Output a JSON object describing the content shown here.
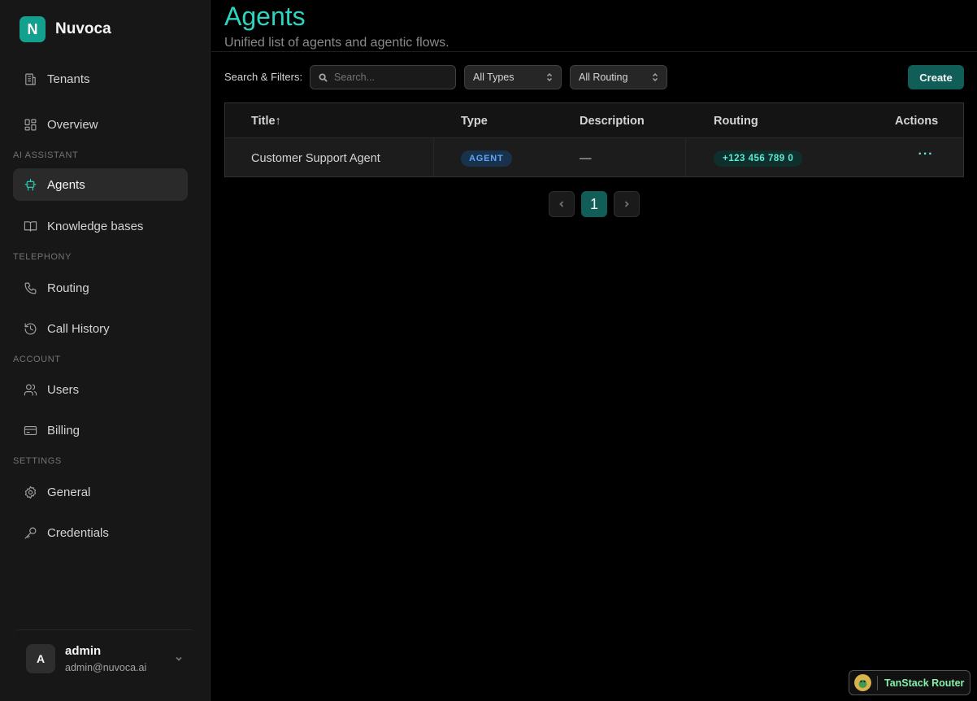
{
  "brand": {
    "logo_letter": "N",
    "name": "Nuvoca"
  },
  "sidebar": {
    "items": [
      {
        "label": "Tenants",
        "icon": "building-icon"
      },
      {
        "label": "Overview",
        "icon": "dashboard-icon"
      },
      {
        "label": "Agents",
        "icon": "bot-icon",
        "active": true
      },
      {
        "label": "Knowledge bases",
        "icon": "book-icon"
      },
      {
        "label": "Routing",
        "icon": "phone-icon"
      },
      {
        "label": "Call History",
        "icon": "history-icon"
      },
      {
        "label": "Users",
        "icon": "users-icon"
      },
      {
        "label": "Billing",
        "icon": "credit-card-icon"
      },
      {
        "label": "General",
        "icon": "gear-icon"
      },
      {
        "label": "Credentials",
        "icon": "key-icon"
      }
    ],
    "sections": [
      "AI ASSISTANT",
      "TELEPHONY",
      "ACCOUNT",
      "SETTINGS"
    ]
  },
  "user": {
    "avatar_letter": "A",
    "name": "admin",
    "email": "admin@nuvoca.ai"
  },
  "page": {
    "title": "Agents",
    "subtitle": "Unified list of agents and agentic flows."
  },
  "filters": {
    "label": "Search & Filters:",
    "search_placeholder": "Search...",
    "type_select": "All Types",
    "routing_select": "All Routing",
    "create_label": "Create"
  },
  "table": {
    "columns": [
      "Title↑",
      "Type",
      "Description",
      "Routing",
      "Actions"
    ],
    "rows": [
      {
        "title": "Customer Support Agent",
        "type": "AGENT",
        "description": "—",
        "routing": "+123 456 789 0",
        "actions": "···"
      }
    ]
  },
  "pagination": {
    "current": "1"
  },
  "devtools": {
    "label": "TanStack Router"
  },
  "colors": {
    "accent": "#2dd4bf",
    "primary": "#115e59",
    "agent_badge": "#60a5fa"
  }
}
